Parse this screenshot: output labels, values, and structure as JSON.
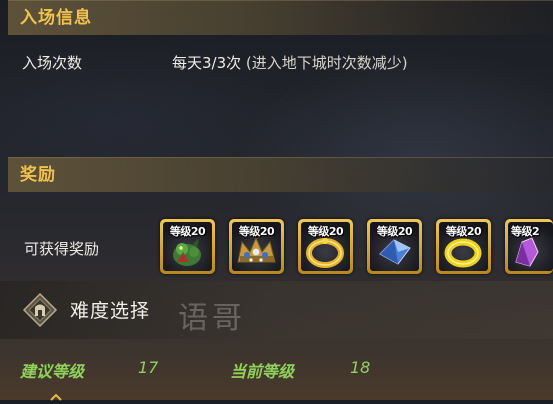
{
  "entry_section": {
    "title": "入场信息",
    "label": "入场次数",
    "value": "每天3/3次",
    "note": " (进入地下城时次数减少)"
  },
  "reward_section": {
    "title": "奖励",
    "label": "可获得奖励",
    "items": [
      {
        "level": "等级20",
        "icon": "green-creature-icon"
      },
      {
        "level": "等级20",
        "icon": "jeweled-crown-icon"
      },
      {
        "level": "等级20",
        "icon": "gold-ring-icon"
      },
      {
        "level": "等级20",
        "icon": "blue-crystal-icon"
      },
      {
        "level": "等级20",
        "icon": "gold-ring-icon"
      },
      {
        "level": "等级2",
        "icon": "purple-crystal-icon"
      }
    ]
  },
  "difficulty": {
    "title": "难度选择",
    "watermark": "语哥",
    "recommended_label": "建议等级",
    "recommended_value": "17",
    "current_label": "当前等级",
    "current_value": "18"
  },
  "colors": {
    "header_title": "#f3c24d",
    "level_text": "#8fd15a",
    "slot_border": "#e0b040"
  }
}
